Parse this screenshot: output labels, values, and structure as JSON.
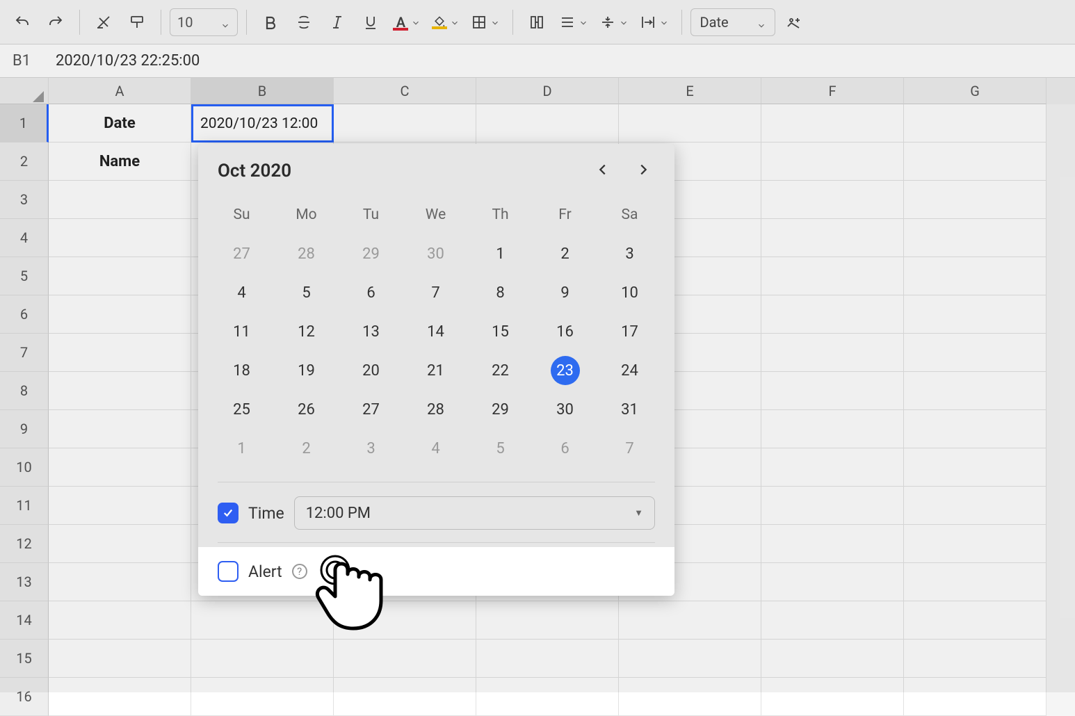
{
  "toolbar": {
    "fontsize": "10",
    "format_select": "Date"
  },
  "namebar": {
    "cellref": "B1",
    "formula": "2020/10/23 22:25:00"
  },
  "columns": [
    "A",
    "B",
    "C",
    "D",
    "E",
    "F",
    "G"
  ],
  "rows_count": 16,
  "cells": {
    "A1": "Date",
    "B1": "2020/10/23 12:00",
    "A2": "Name"
  },
  "selected_cell": "B1",
  "datepicker": {
    "title": "Oct 2020",
    "dow": [
      "Su",
      "Mo",
      "Tu",
      "We",
      "Th",
      "Fr",
      "Sa"
    ],
    "weeks": [
      [
        {
          "d": "27",
          "m": true
        },
        {
          "d": "28",
          "m": true
        },
        {
          "d": "29",
          "m": true
        },
        {
          "d": "30",
          "m": true
        },
        {
          "d": "1"
        },
        {
          "d": "2"
        },
        {
          "d": "3"
        }
      ],
      [
        {
          "d": "4"
        },
        {
          "d": "5"
        },
        {
          "d": "6"
        },
        {
          "d": "7"
        },
        {
          "d": "8"
        },
        {
          "d": "9"
        },
        {
          "d": "10"
        }
      ],
      [
        {
          "d": "11"
        },
        {
          "d": "12"
        },
        {
          "d": "13"
        },
        {
          "d": "14"
        },
        {
          "d": "15"
        },
        {
          "d": "16"
        },
        {
          "d": "17"
        }
      ],
      [
        {
          "d": "18"
        },
        {
          "d": "19"
        },
        {
          "d": "20"
        },
        {
          "d": "21"
        },
        {
          "d": "22"
        },
        {
          "d": "23",
          "sel": true
        },
        {
          "d": "24"
        }
      ],
      [
        {
          "d": "25"
        },
        {
          "d": "26"
        },
        {
          "d": "27"
        },
        {
          "d": "28"
        },
        {
          "d": "29"
        },
        {
          "d": "30"
        },
        {
          "d": "31"
        }
      ],
      [
        {
          "d": "1",
          "m": true
        },
        {
          "d": "2",
          "m": true
        },
        {
          "d": "3",
          "m": true
        },
        {
          "d": "4",
          "m": true
        },
        {
          "d": "5",
          "m": true
        },
        {
          "d": "6",
          "m": true
        },
        {
          "d": "7",
          "m": true
        }
      ]
    ],
    "time_checked": true,
    "time_label": "Time",
    "time_value": "12:00 PM",
    "alert_checked": false,
    "alert_label": "Alert"
  }
}
